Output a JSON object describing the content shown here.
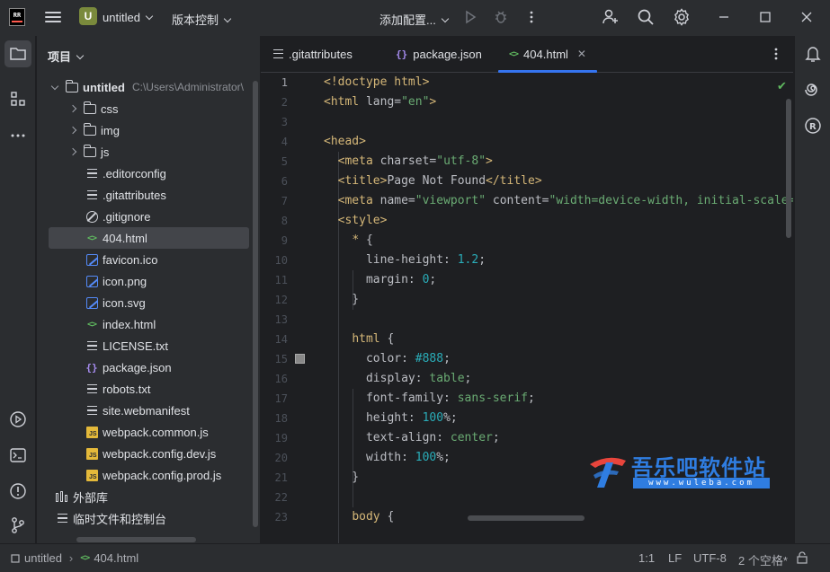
{
  "titlebar": {
    "logo_text": "RR",
    "project_badge": "U",
    "project_name": "untitled",
    "vcs_label": "版本控制",
    "run_config_label": "添加配置..."
  },
  "project_panel": {
    "header": "项目",
    "root": {
      "name": "untitled",
      "path": "C:\\Users\\Administrator\\"
    },
    "items": [
      {
        "name": "css",
        "type": "folder"
      },
      {
        "name": "img",
        "type": "folder"
      },
      {
        "name": "js",
        "type": "folder"
      },
      {
        "name": ".editorconfig",
        "type": "text"
      },
      {
        "name": ".gitattributes",
        "type": "text"
      },
      {
        "name": ".gitignore",
        "type": "ignore"
      },
      {
        "name": "404.html",
        "type": "html"
      },
      {
        "name": "favicon.ico",
        "type": "image"
      },
      {
        "name": "icon.png",
        "type": "image"
      },
      {
        "name": "icon.svg",
        "type": "image"
      },
      {
        "name": "index.html",
        "type": "html"
      },
      {
        "name": "LICENSE.txt",
        "type": "text"
      },
      {
        "name": "package.json",
        "type": "json"
      },
      {
        "name": "robots.txt",
        "type": "text"
      },
      {
        "name": "site.webmanifest",
        "type": "text"
      },
      {
        "name": "webpack.common.js",
        "type": "js"
      },
      {
        "name": "webpack.config.dev.js",
        "type": "js"
      },
      {
        "name": "webpack.config.prod.js",
        "type": "js"
      }
    ],
    "external_libs": "外部库",
    "scratches": "临时文件和控制台"
  },
  "tabs": [
    {
      "label": ".gitattributes",
      "icon": "text-file-icon"
    },
    {
      "label": "package.json",
      "icon": "json-icon"
    },
    {
      "label": "404.html",
      "icon": "html-icon",
      "active": true
    }
  ],
  "editor": {
    "line_numbers": [
      "1",
      "2",
      "3",
      "4",
      "5",
      "6",
      "7",
      "8",
      "9",
      "10",
      "11",
      "12",
      "13",
      "14",
      "15",
      "16",
      "17",
      "18",
      "19",
      "20",
      "21",
      "22",
      "23"
    ],
    "current_line": "1",
    "swatch_color": "#888888"
  },
  "statusbar": {
    "project": "untitled",
    "file": "404.html",
    "position": "1:1",
    "line_sep": "LF",
    "encoding": "UTF-8",
    "indent": "2 个空格*"
  },
  "watermark": {
    "title": "吾乐吧软件站",
    "subtitle": "www.wuleba.com"
  },
  "colors": {
    "accent": "#3574f0",
    "tag": "#d5b778",
    "string": "#6aab73",
    "number": "#2aacb8",
    "keyword": "#cf8e6d"
  }
}
